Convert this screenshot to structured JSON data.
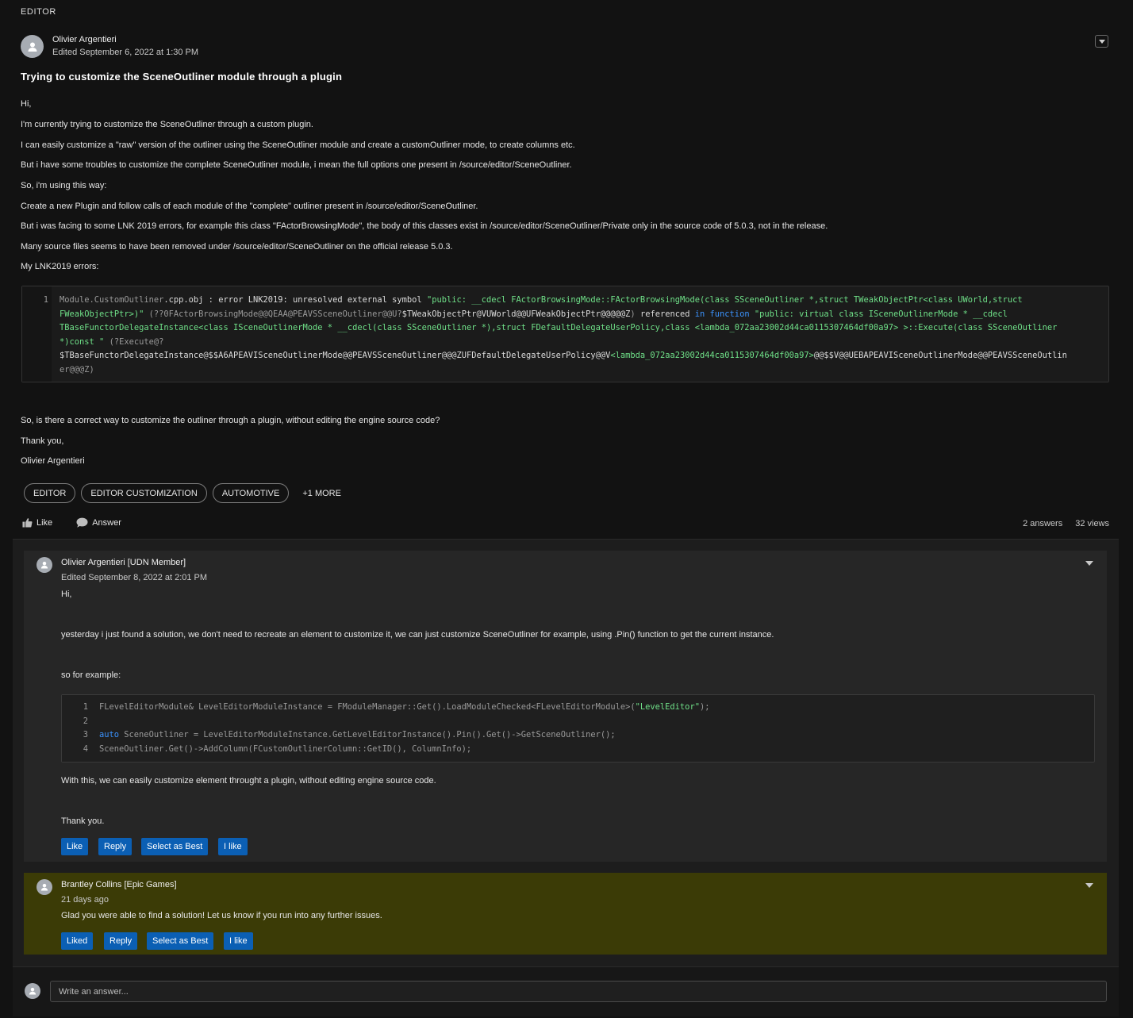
{
  "category": "EDITOR",
  "question": {
    "author": "Olivier Argentieri",
    "edited": "Edited September 6, 2022 at 1:30 PM",
    "title": "Trying to customize the SceneOutliner module through a plugin",
    "paragraphs": [
      "Hi,",
      "I'm currently trying to customize the SceneOutliner through a custom plugin.",
      "I can easily customize a \"raw\" version of the outliner using the SceneOutliner module and create a customOutliner mode, to create columns etc.",
      "But i have some troubles to customize the complete SceneOutliner module, i mean the full options one present in /source/editor/SceneOutliner.",
      "So, i'm using this way:",
      "Create a new Plugin and follow calls of each module of the \"complete\" outliner present in /source/editor/SceneOutliner.",
      "But i was facing to some LNK 2019 errors, for example this class \"FActorBrowsingMode\", the body of this classes exist in /source/editor/SceneOutliner/Private only in the source code of 5.0.3, not in the release.",
      "Many source files seems to have been removed under /source/editor/SceneOutliner on the official release 5.0.3.",
      "My LNK2019 errors:"
    ],
    "code": {
      "line_number": "1",
      "lines": [
        [
          [
            "gray",
            "Module.CustomOutliner"
          ],
          [
            "white",
            ".cpp.obj : error LNK2019: unresolved external symbol "
          ],
          [
            "green",
            "\"public: __cdecl FActorBrowsingMode::FActorBrowsingMode(class SSceneOutliner *,struct TWeakObjectPtr<class UWorld,struct"
          ]
        ],
        [
          [
            "green",
            "FWeakObjectPtr>)\""
          ],
          [
            "gray",
            " (??0FActorBrowsingMode@@QEAA@PEAVSSceneOutliner@@U?"
          ],
          [
            "white",
            "$TWeakObjectPtr@VUWorld@@UFWeakObjectPtr@@@@@Z"
          ],
          [
            "gray",
            ")"
          ],
          [
            "white",
            " referenced "
          ],
          [
            "blue",
            "in function"
          ],
          [
            "green",
            " \"public: virtual class ISceneOutlinerMode * __cdecl"
          ]
        ],
        [
          [
            "green",
            "TBaseFunctorDelegateInstance<class ISceneOutlinerMode * __cdecl(class SSceneOutliner *),struct FDefaultDelegateUserPolicy,class <lambda_072aa23002d44ca0115307464df00a97> >::Execute(class SSceneOutliner"
          ]
        ],
        [
          [
            "green",
            "*)const \""
          ],
          [
            "gray",
            " (?Execute@?"
          ]
        ],
        [
          [
            "white",
            "$TBaseFunctorDelegateInstance@$$A6APEAVISceneOutlinerMode@@PEAVSSceneOutliner@@@ZUFDefaultDelegateUserPolicy@@V"
          ],
          [
            "green",
            "<lambda_072aa23002d44ca0115307464df00a97>"
          ],
          [
            "white",
            "@@$$V@@UEBAPEAVISceneOutlinerMode@@PEAVSSceneOutlin"
          ]
        ],
        [
          [
            "gray",
            "er@@@Z)"
          ]
        ]
      ]
    },
    "after_paragraphs": [
      "So, is there a correct way to customize the outliner through a plugin, without editing the engine source code?",
      "Thank you,",
      "Olivier Argentieri"
    ],
    "tags": [
      "EDITOR",
      "EDITOR CUSTOMIZATION",
      "AUTOMOTIVE"
    ],
    "more_tags": "+1 MORE",
    "like_label": "Like",
    "answer_label": "Answer",
    "answers_count": "2 answers",
    "views_count": "32 views"
  },
  "answers": [
    {
      "author": "Olivier Argentieri [UDN Member]",
      "edited": "Edited September 8, 2022 at 2:01 PM",
      "p1": "Hi,",
      "p2": "yesterday i just found a solution, we don't need to recreate an element to customize it, we can just customize SceneOutliner for example, using .Pin() function to get the current instance.",
      "p3": "so for example:",
      "code": {
        "line_numbers": [
          "1",
          "2",
          "3",
          "4"
        ],
        "lines": [
          [
            [
              "gray",
              "FLevelEditorModule& LevelEditorModuleInstance = FModuleManager::Get().LoadModuleChecked<FLevelEditorModule>("
            ],
            [
              "green",
              "\"LevelEditor\""
            ],
            [
              "gray",
              ");"
            ]
          ],
          [
            [
              "gray",
              ""
            ]
          ],
          [
            [
              "blue",
              "auto"
            ],
            [
              "gray",
              " SceneOutliner = LevelEditorModuleInstance.GetLevelEditorInstance().Pin().Get()->GetSceneOutliner();"
            ]
          ],
          [
            [
              "gray",
              "SceneOutliner.Get()->AddColumn(FCustomOutlinerColumn::GetID(), ColumnInfo);"
            ]
          ]
        ]
      },
      "p4": "With this, we can easily customize element throught a plugin, without editing engine source code.",
      "p5": "Thank you.",
      "buttons": [
        "Like",
        "Reply",
        "Select as Best",
        "I like"
      ]
    },
    {
      "author": "Brantley Collins [Epic Games]",
      "edited": "21 days ago",
      "p1": "Glad you were able to find a solution! Let us know if you run into any further issues.",
      "buttons": [
        "Liked",
        "Reply",
        "Select as Best",
        "I like"
      ],
      "highlight_color": "#3b3b06"
    }
  ],
  "reply": {
    "placeholder": "Write an answer..."
  }
}
